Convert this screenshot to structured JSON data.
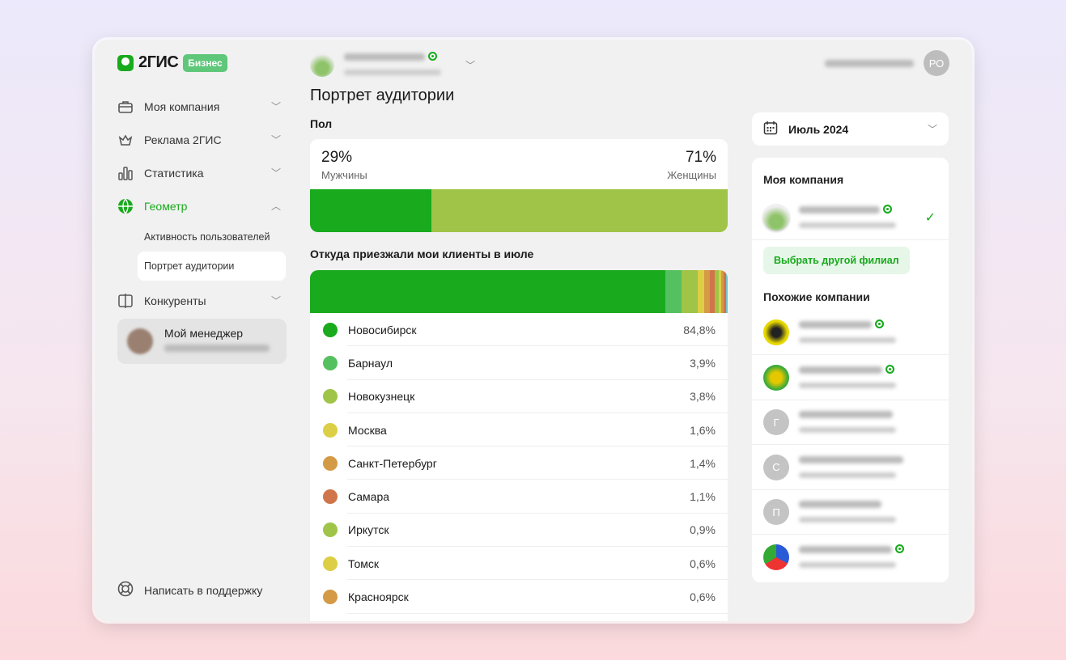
{
  "logo": {
    "name": "2ГИС",
    "badge": "Бизнес"
  },
  "sidebar": {
    "items": [
      {
        "label": "Моя компания",
        "icon": "briefcase-icon"
      },
      {
        "label": "Реклама 2ГИС",
        "icon": "crown-icon"
      },
      {
        "label": "Статистика",
        "icon": "bar-chart-icon"
      },
      {
        "label": "Геометр",
        "icon": "globe-icon"
      },
      {
        "label": "Конкуренты",
        "icon": "compare-icon"
      }
    ],
    "subitems": [
      "Активность пользователей",
      "Портрет аудитории"
    ],
    "manager": "Мой менеджер",
    "support": "Написать в поддержку"
  },
  "header": {
    "user_initials": "РО"
  },
  "main": {
    "title": "Портрет аудитории",
    "gender_label": "Пол",
    "gender": {
      "male_pct": "29%",
      "male_label": "Мужчины",
      "female_pct": "71%",
      "female_label": "Женщины",
      "male_value": 29,
      "female_value": 71,
      "male_color": "#19aa1e",
      "female_color": "#9fc447"
    },
    "cities_label": "Откуда приезжали мои клиенты в июле",
    "cities": [
      {
        "name": "Новосибирск",
        "pct": "84,8%",
        "value": 84.8,
        "color": "#19aa1e"
      },
      {
        "name": "Барнаул",
        "pct": "3,9%",
        "value": 3.9,
        "color": "#55c060"
      },
      {
        "name": "Новокузнецк",
        "pct": "3,8%",
        "value": 3.8,
        "color": "#9fc447"
      },
      {
        "name": "Москва",
        "pct": "1,6%",
        "value": 1.6,
        "color": "#dccf45"
      },
      {
        "name": "Санкт-Петербург",
        "pct": "1,4%",
        "value": 1.4,
        "color": "#d49a45"
      },
      {
        "name": "Самара",
        "pct": "1,1%",
        "value": 1.1,
        "color": "#d0744a"
      },
      {
        "name": "Иркутск",
        "pct": "0,9%",
        "value": 0.9,
        "color": "#9fc447"
      },
      {
        "name": "Томск",
        "pct": "0,6%",
        "value": 0.6,
        "color": "#dccf45"
      },
      {
        "name": "Красноярск",
        "pct": "0,6%",
        "value": 0.6,
        "color": "#d49a45"
      }
    ],
    "cities_rest": [
      {
        "value": 0.6,
        "color": "#d0744a"
      },
      {
        "value": 0.4,
        "color": "#74c2c8"
      }
    ]
  },
  "right": {
    "date": "Июль 2024",
    "my_company": "Моя компания",
    "choose_branch": "Выбрать другой филиал",
    "similar": "Похожие компании",
    "similar_avatars": [
      "",
      "",
      "Г",
      "С",
      "П",
      ""
    ]
  }
}
